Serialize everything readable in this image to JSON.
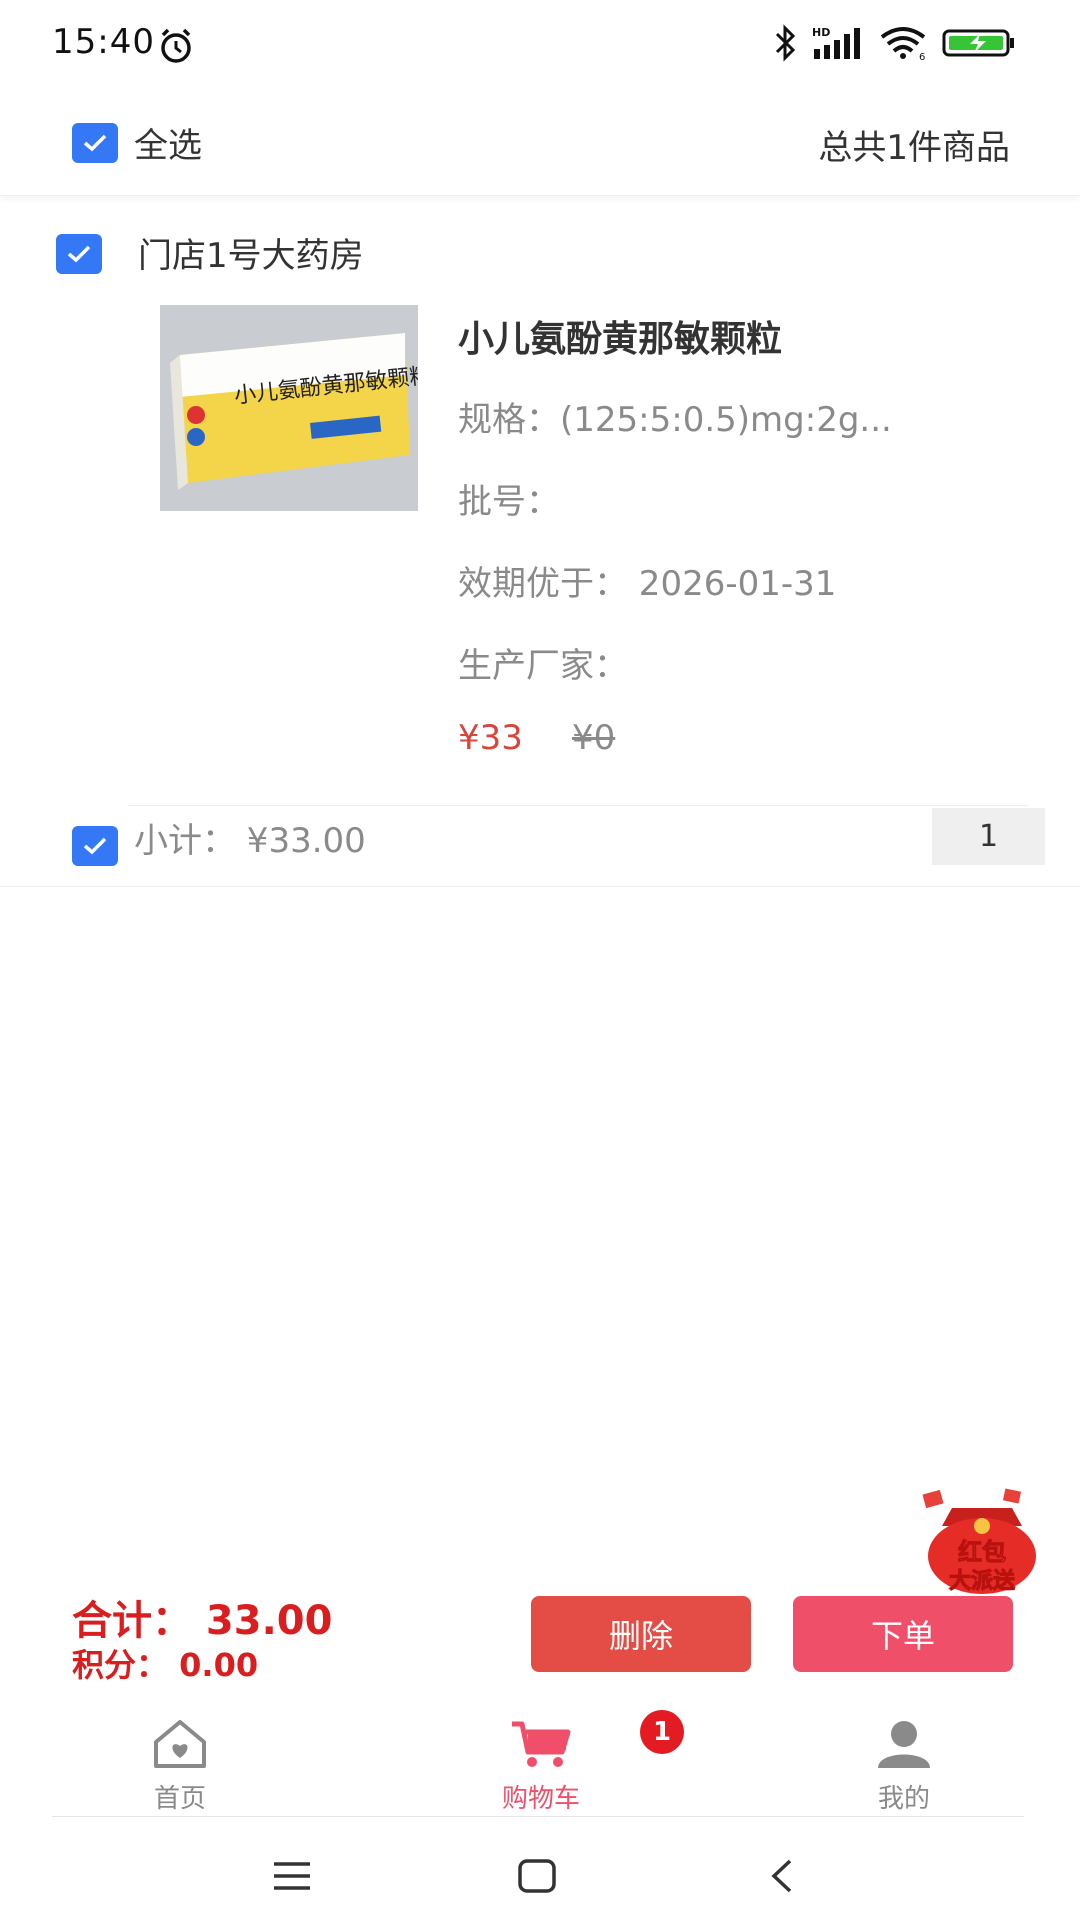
{
  "status_bar": {
    "time": "15:40"
  },
  "header": {
    "select_all_label": "全选",
    "total_items": "总共1件商品"
  },
  "store": {
    "name": "门店1号大药房"
  },
  "product": {
    "title": "小儿氨酚黄那敏颗粒",
    "spec": "规格：(125:5:0.5)mg:2g...",
    "batch": "批号：",
    "expiry": "效期优于：  2026-01-31",
    "manufacturer": "生产厂家：",
    "price": "¥33",
    "original_price": "¥0",
    "box_text": "小儿氨酚黄那敏颗粒"
  },
  "cart_line": {
    "subtotal": "小计：  ¥33.00",
    "quantity": "1"
  },
  "summary": {
    "total": "合计：  33.00",
    "points": "积分：  0.00"
  },
  "actions": {
    "delete_label": "删除",
    "order_label": "下单"
  },
  "promo": {
    "text_line1": "红包",
    "text_line2": "大派送"
  },
  "tabs": {
    "home": "首页",
    "cart": "购物车",
    "mine": "我的",
    "cart_badge": "1"
  },
  "colors": {
    "checkbox_blue": "#3478f6",
    "price_red": "#d9453c",
    "total_red": "#d81e1e",
    "delete_btn": "#e34d45",
    "order_btn": "#f04f6a",
    "tab_active": "#f04f6a",
    "tab_inactive": "#8a8a8a"
  }
}
